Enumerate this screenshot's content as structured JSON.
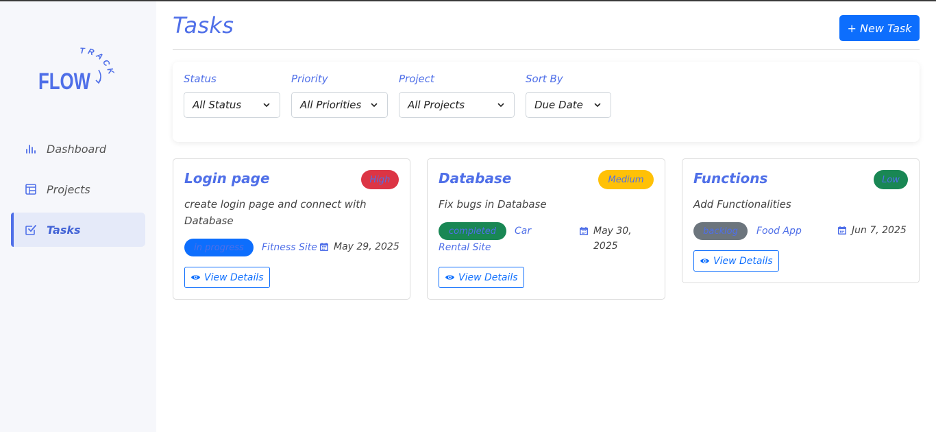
{
  "brand": {
    "logo_word": "FLOW",
    "logo_arc": "TRACK"
  },
  "sidebar": {
    "items": [
      {
        "label": "Dashboard",
        "icon": "bar-chart-icon",
        "active": false
      },
      {
        "label": "Projects",
        "icon": "layout-icon",
        "active": false
      },
      {
        "label": "Tasks",
        "icon": "check-square-icon",
        "active": true
      }
    ]
  },
  "header": {
    "title": "Tasks",
    "new_task_label": "+ New Task"
  },
  "filters": {
    "status": {
      "label": "Status",
      "value": "All Status"
    },
    "priority": {
      "label": "Priority",
      "value": "All Priorities"
    },
    "project": {
      "label": "Project",
      "value": "All Projects"
    },
    "sort": {
      "label": "Sort By",
      "value": "Due Date"
    }
  },
  "tasks": [
    {
      "title": "Login page",
      "priority": "High",
      "description": "create login page and connect with Database",
      "status": "in progress",
      "project": "Fitness Site",
      "due": "May 29, 2025",
      "view_label": "View Details"
    },
    {
      "title": "Database",
      "priority": "Medium",
      "description": "Fix bugs in Database",
      "status": "completed",
      "project": "Car Rental Site",
      "due": "May 30, 2025",
      "view_label": "View Details"
    },
    {
      "title": "Functions",
      "priority": "Low",
      "description": "Add Functionalities",
      "status": "backlog",
      "project": "Food App",
      "due": "Jun 7, 2025",
      "view_label": "View Details"
    }
  ],
  "colors": {
    "accent": "#4f6fe8",
    "primary_button": "#0d6efd",
    "priority_high": "#dc3545",
    "priority_medium": "#ffc107",
    "priority_low": "#198754",
    "status_in_progress": "#0d6efd",
    "status_completed": "#198754",
    "status_backlog": "#6c757d"
  }
}
